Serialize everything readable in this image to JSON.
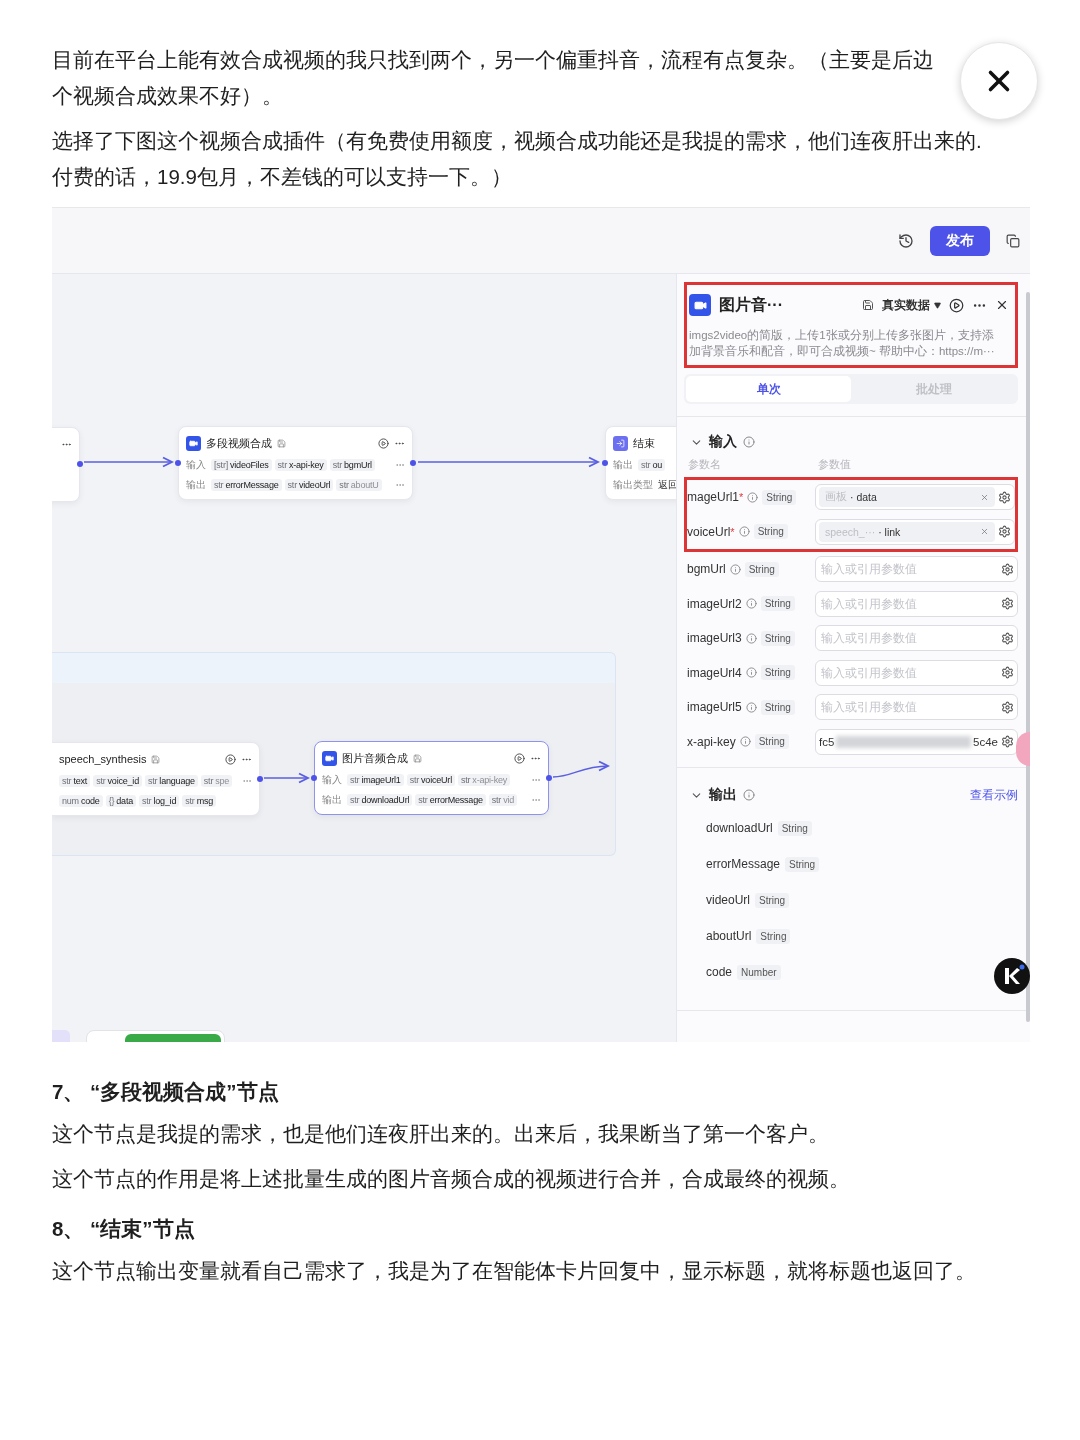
{
  "article_top": [
    {
      "lines": [
        "目前在平台上能有效合成视频的我只找到两个，另一个偏重抖音，流程有点复杂。（主要是后边",
        "个视频合成效果不好）。"
      ]
    },
    {
      "lines": [
        "选择了下图这个视频合成插件（有免费使用额度，视频合成功能还是我提的需求，他们连夜肝出来的.",
        "付费的话，19.9包月，不差钱的可以支持一下。）"
      ]
    }
  ],
  "screenshot": {
    "toolbar": {
      "publish_button": "发布"
    },
    "canvas": {
      "nodes": [
        {
          "title": "多段视频合成",
          "kind": "plugin",
          "selected": false,
          "rows": [
            {
              "label": "输入",
              "more": true,
              "items": [
                {
                  "kind": "chip",
                  "type": "[str]",
                  "name": "videoFiles",
                  "faded": false
                },
                {
                  "kind": "chip",
                  "type": "str",
                  "name": "x-api-key",
                  "faded": false
                },
                {
                  "kind": "chip",
                  "type": "str",
                  "name": "bgmUrl",
                  "faded": false
                }
              ]
            },
            {
              "label": "输出",
              "more": true,
              "items": [
                {
                  "kind": "chip",
                  "type": "str",
                  "name": "errorMessage",
                  "faded": false
                },
                {
                  "kind": "chip",
                  "type": "str",
                  "name": "videoUrl",
                  "faded": false
                },
                {
                  "kind": "chip",
                  "type": "str",
                  "name": "aboutU",
                  "faded": true
                }
              ]
            }
          ]
        },
        {
          "title": "结束",
          "kind": "end",
          "selected": false,
          "rows": [
            {
              "label": "输出",
              "more": false,
              "items": [
                {
                  "kind": "chip",
                  "type": "str",
                  "name": "ou",
                  "faded": false
                }
              ]
            },
            {
              "label": "输出类型",
              "more": false,
              "items": [
                {
                  "kind": "text",
                  "name": "返回"
                }
              ]
            }
          ]
        },
        {
          "title": "speech_synthesis",
          "kind": "plugin_cut",
          "selected": false,
          "rows": [
            {
              "more": true,
              "items": [
                {
                  "kind": "chip",
                  "type": "str",
                  "name": "text",
                  "faded": false
                },
                {
                  "kind": "chip",
                  "type": "str",
                  "name": "voice_id",
                  "faded": false
                },
                {
                  "kind": "chip",
                  "type": "str",
                  "name": "language",
                  "faded": false
                },
                {
                  "kind": "chip",
                  "type": "str",
                  "name": "spe",
                  "faded": true
                }
              ]
            },
            {
              "more": false,
              "items": [
                {
                  "kind": "chip",
                  "type": "num",
                  "name": "code",
                  "faded": false
                },
                {
                  "kind": "chip",
                  "type": "{}",
                  "name": "data",
                  "faded": false
                },
                {
                  "kind": "chip",
                  "type": "str",
                  "name": "log_id",
                  "faded": false
                },
                {
                  "kind": "chip",
                  "type": "str",
                  "name": "msg",
                  "faded": false
                }
              ]
            }
          ]
        },
        {
          "title": "图片音频合成",
          "kind": "plugin",
          "selected": true,
          "rows": [
            {
              "label": "输入",
              "more": true,
              "items": [
                {
                  "kind": "chip",
                  "type": "str",
                  "name": "imageUrl1",
                  "faded": false
                },
                {
                  "kind": "chip",
                  "type": "str",
                  "name": "voiceUrl",
                  "faded": false
                },
                {
                  "kind": "chip",
                  "type": "str",
                  "name": "x-api-key",
                  "faded": true
                }
              ]
            },
            {
              "label": "输出",
              "more": true,
              "items": [
                {
                  "kind": "chip",
                  "type": "str",
                  "name": "downloadUrl",
                  "faded": false
                },
                {
                  "kind": "chip",
                  "type": "str",
                  "name": "errorMessage",
                  "faded": false
                },
                {
                  "kind": "chip",
                  "type": "str",
                  "name": "vid",
                  "faded": true
                }
              ]
            }
          ]
        }
      ]
    },
    "panel": {
      "title": "图片音···",
      "data_mode": "真实数据",
      "description": [
        "imgs2video的简版，上传1张或分别上传多张图片，支持添",
        "加背景音乐和配音，即可合成视频~ 帮助中心：https://m···"
      ],
      "tabs": [
        {
          "label": "单次",
          "selected": true
        },
        {
          "label": "批处理",
          "selected": false
        }
      ],
      "input_section": {
        "title": "输入",
        "expanded": true,
        "columns": [
          "参数名",
          "参数值"
        ]
      },
      "params": [
        {
          "name": "mageUrl1",
          "required_mark": "*",
          "type": "String",
          "highlighted": true,
          "kind": "ref",
          "source": "画板",
          "field": "· data"
        },
        {
          "name": "voiceUrl",
          "required_mark": "*",
          "type": "String",
          "highlighted": true,
          "kind": "ref",
          "source": "speech_···",
          "field": "· link"
        },
        {
          "name": "bgmUrl",
          "type": "String",
          "highlighted": false,
          "kind": "empty",
          "placeholder": "输入或引用参数值"
        },
        {
          "name": "imageUrl2",
          "type": "String",
          "highlighted": false,
          "kind": "empty",
          "placeholder": "输入或引用参数值"
        },
        {
          "name": "imageUrl3",
          "type": "String",
          "highlighted": false,
          "kind": "empty",
          "placeholder": "输入或引用参数值"
        },
        {
          "name": "imageUrl4",
          "type": "String",
          "highlighted": false,
          "kind": "empty",
          "placeholder": "输入或引用参数值"
        },
        {
          "name": "imageUrl5",
          "type": "String",
          "highlighted": false,
          "kind": "empty",
          "placeholder": "输入或引用参数值"
        },
        {
          "name": "x-api-key",
          "type": "String",
          "highlighted": false,
          "kind": "secret",
          "value": "fc5",
          "value_tail": "5c4e"
        }
      ],
      "output_section": {
        "title": "输出",
        "expanded": true,
        "link": "查看示例"
      },
      "outputs": [
        {
          "name": "downloadUrl",
          "type": "String"
        },
        {
          "name": "errorMessage",
          "type": "String"
        },
        {
          "name": "videoUrl",
          "type": "String"
        },
        {
          "name": "aboutUrl",
          "type": "String"
        },
        {
          "name": "code",
          "type": "Number"
        }
      ]
    }
  },
  "article_bottom": [
    {
      "kind": "heading",
      "text": "7、 “多段视频合成”节点"
    },
    {
      "kind": "paragraph",
      "text": "这个节点是我提的需求，也是他们连夜肝出来的。出来后，我果断当了第一个客户。"
    },
    {
      "kind": "paragraph",
      "text": "这个节点的作用是将上述批量生成的图片音频合成的视频进行合并，合成最终的视频。"
    },
    {
      "kind": "heading",
      "text": "8、 “结束”节点"
    },
    {
      "kind": "paragraph",
      "text": "这个节点输出变量就看自己需求了，我是为了在智能体卡片回复中，显示标题，就将标题也返回了。"
    }
  ]
}
